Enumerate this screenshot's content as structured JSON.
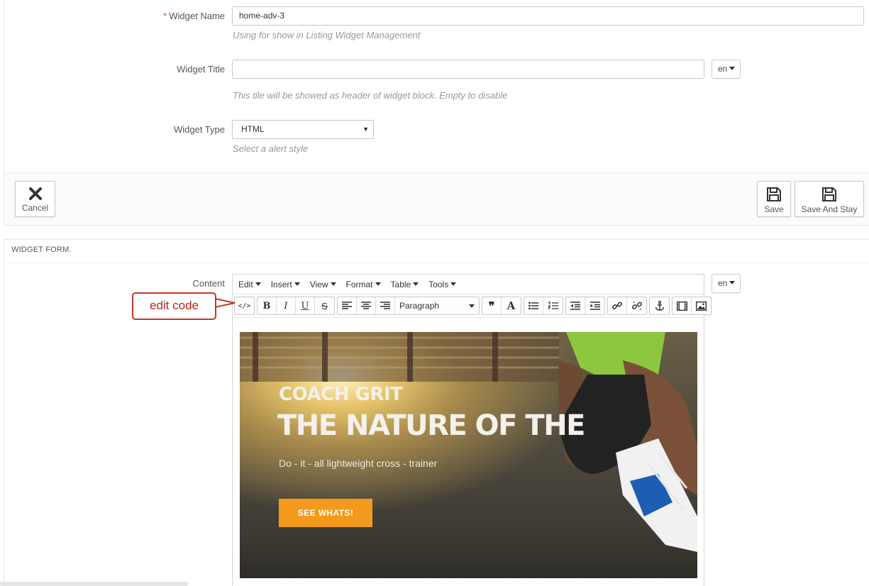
{
  "form": {
    "widget_name": {
      "label": "Widget Name",
      "required_mark": "*",
      "value": "home-adv-3",
      "help": "Using for show in Listing Widget Management"
    },
    "widget_title": {
      "label": "Widget Title",
      "value": "",
      "lang": "en",
      "help": "This tile will be showed as header of widget block. Empty to disable"
    },
    "widget_type": {
      "label": "Widget Type",
      "selected": "HTML",
      "help": "Select a alert style"
    }
  },
  "actions": {
    "cancel": "Cancel",
    "save": "Save",
    "save_and_stay": "Save And Stay"
  },
  "widget_form": {
    "heading": "WIDGET FORM.",
    "content_label": "Content",
    "lang": "en",
    "menubar": [
      "Edit",
      "Insert",
      "View",
      "Format",
      "Table",
      "Tools"
    ],
    "block_format": "Paragraph",
    "toolbar_icons": [
      "code-icon",
      "bold-icon",
      "italic-icon",
      "underline-icon",
      "strikethrough-icon",
      "align-left-icon",
      "align-center-icon",
      "align-right-icon",
      "blockquote-icon",
      "text-color-icon",
      "bullet-list-icon",
      "numbered-list-icon",
      "outdent-icon",
      "indent-icon",
      "link-icon",
      "unlink-icon",
      "anchor-icon",
      "media-icon",
      "image-icon"
    ]
  },
  "banner": {
    "title_small": "COACH GRIT",
    "title_large": "THE NATURE OF THE",
    "subtitle": "Do - it - all lightweight cross - trainer",
    "cta": "SEE WHATS!",
    "cta_color": "#f39a1c"
  },
  "annotation": {
    "callout": "edit code",
    "callout_color": "#c0392b"
  }
}
